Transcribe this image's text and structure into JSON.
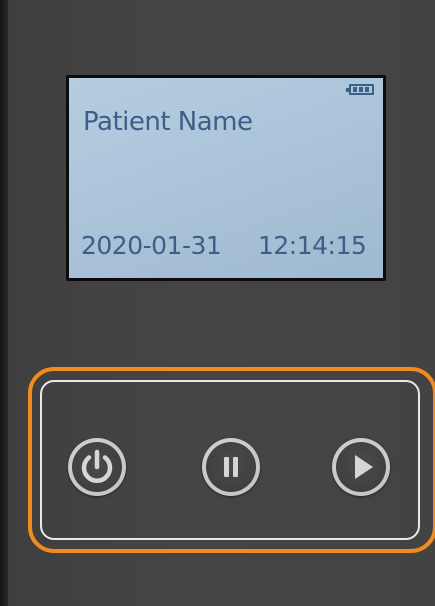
{
  "screen": {
    "patient_name": "Patient Name",
    "date": "2020-01-31",
    "time": "12:14:15",
    "battery_icon": "battery-full-icon"
  },
  "controls": {
    "buttons": [
      {
        "name": "power-button",
        "icon": "power-icon"
      },
      {
        "name": "pause-button",
        "icon": "pause-icon"
      },
      {
        "name": "play-button",
        "icon": "play-icon"
      }
    ]
  },
  "colors": {
    "lcd_background": "#b0c8dc",
    "lcd_text": "#3b5f86",
    "device_body": "#434343",
    "highlight": "#f28a1e",
    "button_ring": "#c6c6c6"
  }
}
